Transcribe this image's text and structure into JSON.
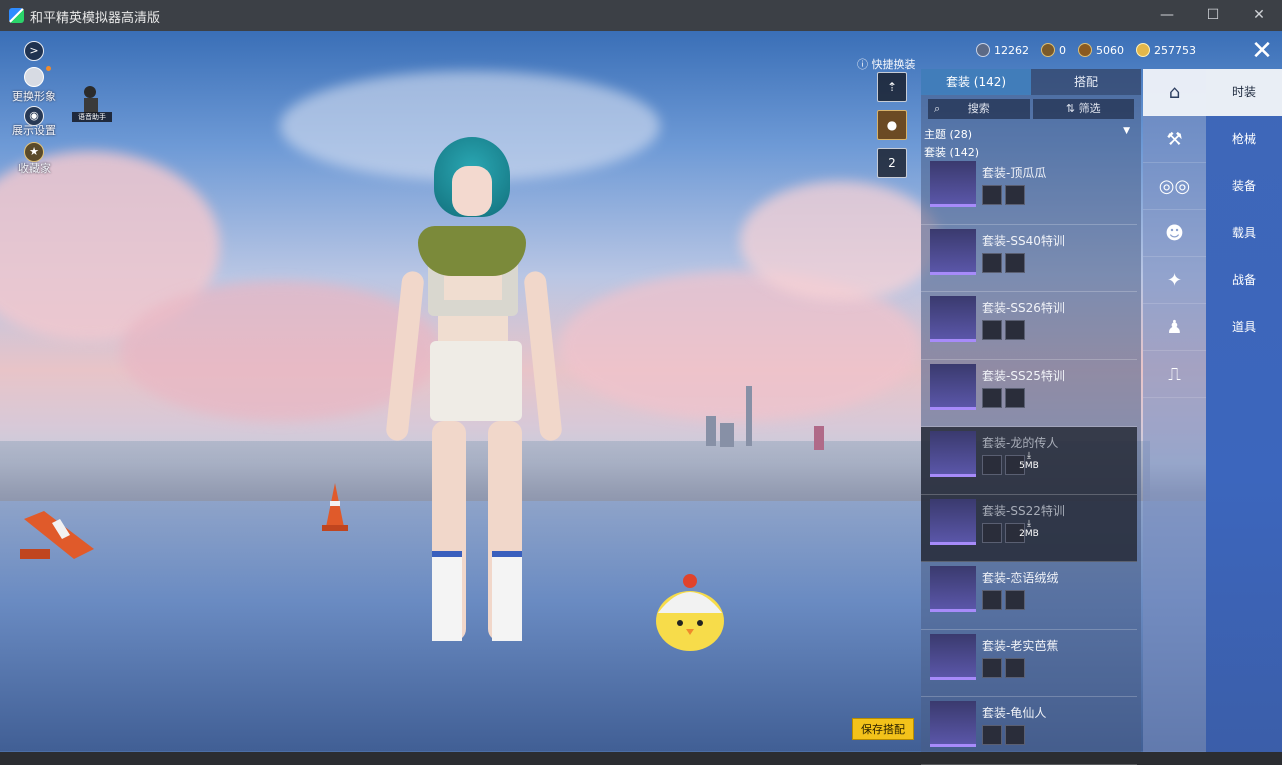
{
  "window": {
    "title": "和平精英模拟器高清版",
    "controls": {
      "minimize": "—",
      "maximize": "☐",
      "close": "✕"
    }
  },
  "left_toolbar": {
    "items": [
      {
        "label": "",
        "icon": "chevron-right-icon"
      },
      {
        "label": "更换形象",
        "icon": "avatar-icon"
      },
      {
        "label": "展示设置",
        "icon": "eye-icon"
      },
      {
        "label": "收藏家",
        "icon": "collector-icon"
      }
    ],
    "assistant_label": "语音助手"
  },
  "currency": [
    {
      "icon": "coin-silver-icon",
      "value": "12262"
    },
    {
      "icon": "coin-bronze-icon",
      "value": "0"
    },
    {
      "icon": "coin-medal-icon",
      "value": "5060"
    },
    {
      "icon": "coin-gold-icon",
      "value": "257753"
    }
  ],
  "quick_change": {
    "label": "快捷换装",
    "slot_number": "2"
  },
  "panel": {
    "tabs": [
      {
        "label": "套装 (142)",
        "active": true
      },
      {
        "label": "搭配",
        "active": false
      }
    ],
    "search_label": "搜索",
    "filter_label": "筛选",
    "theme_label": "主题 (28)",
    "suit_label": "套装 (142)",
    "items": [
      {
        "name": "套装-顶瓜瓜",
        "dim": false,
        "download": ""
      },
      {
        "name": "套装-SS40特训",
        "dim": false,
        "download": ""
      },
      {
        "name": "套装-SS26特训",
        "dim": false,
        "download": ""
      },
      {
        "name": "套装-SS25特训",
        "dim": false,
        "download": ""
      },
      {
        "name": "套装-龙的传人",
        "dim": true,
        "download": "5MB"
      },
      {
        "name": "套装-SS22特训",
        "dim": true,
        "download": "2MB"
      },
      {
        "name": "套装-恋语绒绒",
        "dim": false,
        "download": ""
      },
      {
        "name": "套装-老实芭蕉",
        "dim": false,
        "download": ""
      },
      {
        "name": "套装-龟仙人",
        "dim": false,
        "download": ""
      }
    ]
  },
  "category_icons": [
    {
      "icon": "outfit-icon",
      "active": true
    },
    {
      "icon": "weapon-icon",
      "active": false
    },
    {
      "icon": "goggles-icon",
      "active": false
    },
    {
      "icon": "mask-icon",
      "active": false
    },
    {
      "icon": "vehicle-icon",
      "active": false
    },
    {
      "icon": "figure-icon",
      "active": false
    },
    {
      "icon": "boots-icon",
      "active": false
    }
  ],
  "categories": [
    {
      "label": "时装",
      "active": true
    },
    {
      "label": "枪械",
      "active": false
    },
    {
      "label": "装备",
      "active": false
    },
    {
      "label": "载具",
      "active": false
    },
    {
      "label": "战备",
      "active": false
    },
    {
      "label": "道具",
      "active": false
    }
  ],
  "save_button": "保存搭配",
  "colors": {
    "accent": "#3e67b8",
    "save": "#f3c21a",
    "active_tab": "#4080be"
  }
}
